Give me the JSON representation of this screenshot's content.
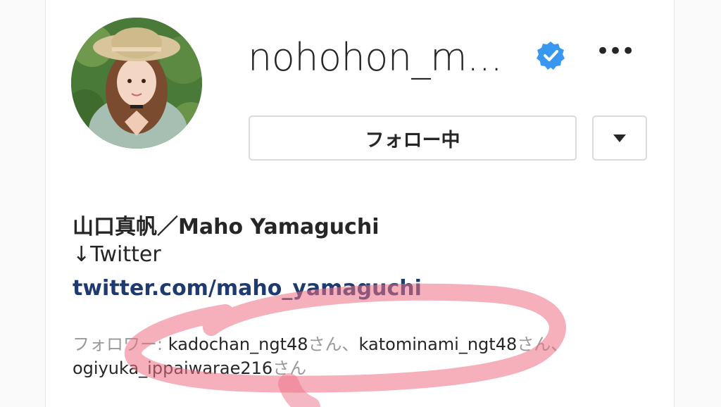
{
  "profile": {
    "username": "nohohon_m...",
    "follow_button_label": "フォロー中",
    "more_icon_glyph": "•••",
    "full_name": "山口真帆／Maho Yamaguchi",
    "bio_line": "↓Twitter",
    "bio_link": "twitter.com/maho_yamaguchi",
    "followed_by": {
      "prefix": "フォロワー: ",
      "accounts": [
        "kadochan_ngt48",
        "katominami_ngt48",
        "ogiyuka_ippaiwarae216"
      ],
      "suffix": "さん",
      "separator": "、"
    }
  },
  "icons": {
    "verified": "verified-badge-icon",
    "more": "more-options-icon",
    "dropdown": "chevron-down-icon"
  },
  "colors": {
    "verified_blue": "#3897f0",
    "link_navy": "#1e3a6e",
    "muted_gray": "#999999",
    "highlight_pink": "#ec6f85"
  }
}
